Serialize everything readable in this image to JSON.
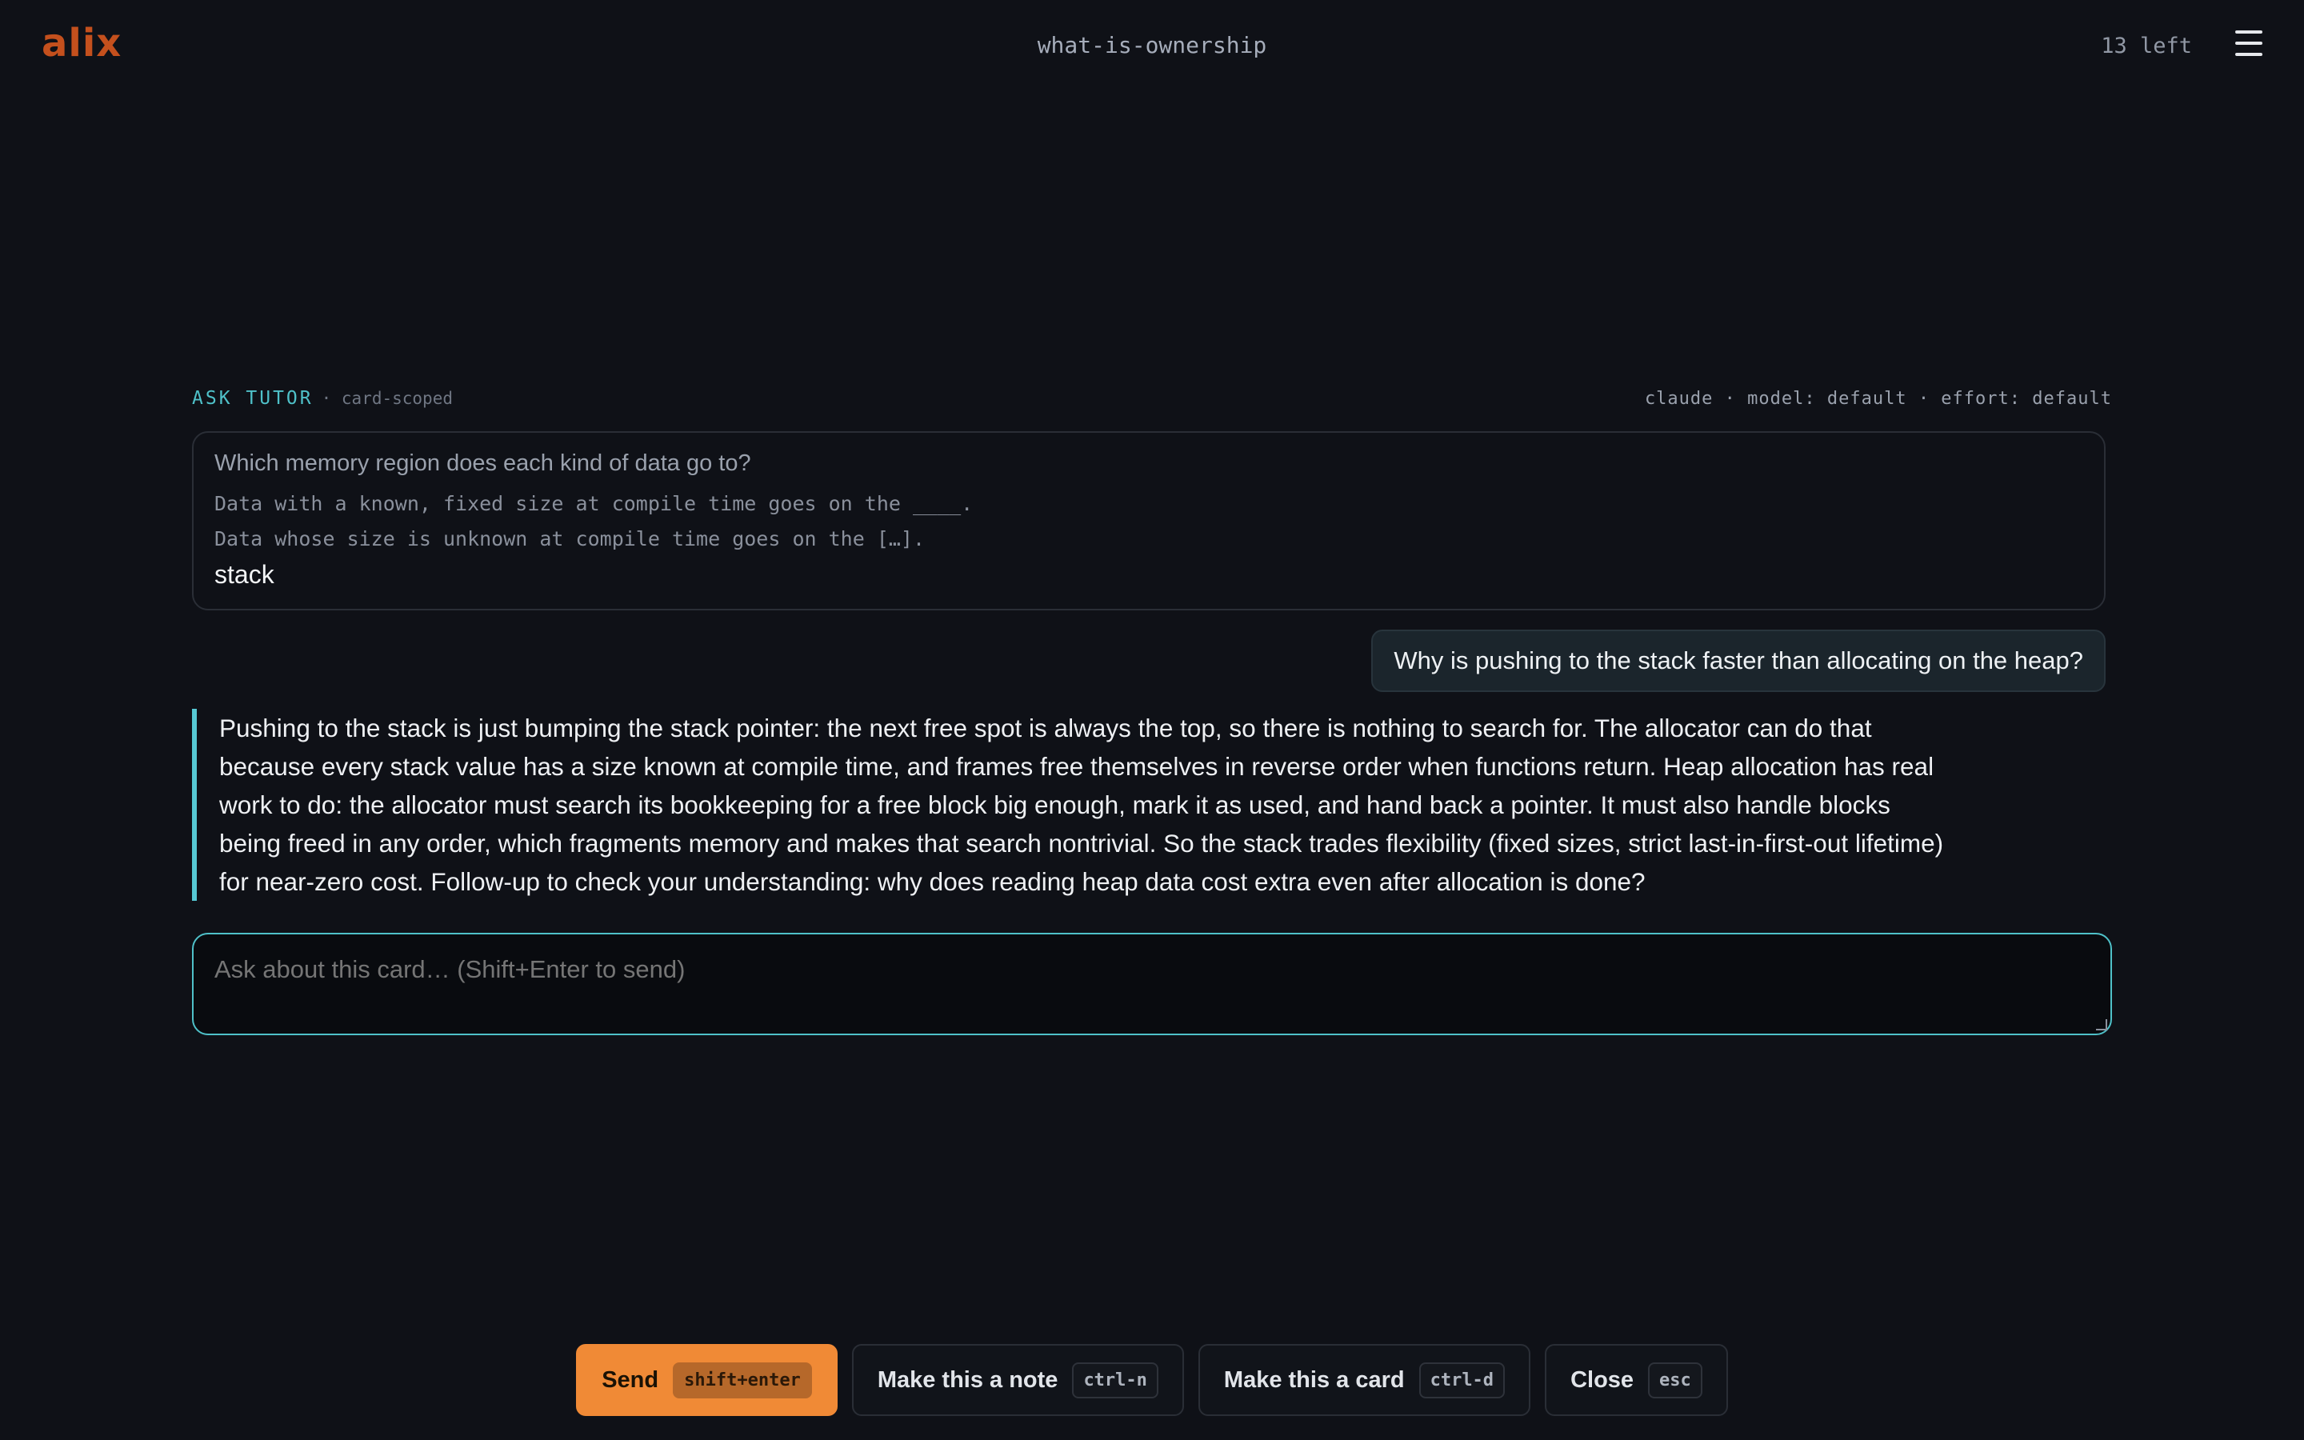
{
  "header": {
    "logo": "alix",
    "deck_title": "what-is-ownership",
    "remaining": "13 left"
  },
  "tutor": {
    "label": "ASK TUTOR",
    "scope": "· card-scoped",
    "model_info": "claude · model: default · effort: default"
  },
  "card": {
    "question": "Which memory region does each kind of data go to?",
    "lines": [
      "Data with a known, fixed size at compile time goes on the ____.",
      "Data whose size is unknown at compile time goes on the […]."
    ],
    "answer": "stack"
  },
  "conversation": {
    "user_message": "Why is pushing to the stack faster than allocating on the heap?",
    "tutor_reply": "Pushing to the stack is just bumping the stack pointer: the next free spot is always the top, so there is nothing to search for. The allocator can do that because every stack value has a size known at compile time, and frames free themselves in reverse order when functions return. Heap allocation has real work to do: the allocator must search its bookkeeping for a free block big enough, mark it as used, and hand back a pointer. It must also handle blocks being freed in any order, which fragments memory and makes that search nontrivial. So the stack trades flexibility (fixed sizes, strict last-in-first-out lifetime) for near-zero cost. Follow-up to check your understanding: why does reading heap data cost extra even after allocation is done?"
  },
  "input": {
    "placeholder": "Ask about this card… (Shift+Enter to send)"
  },
  "actions": {
    "send": {
      "label": "Send",
      "shortcut": "shift+enter"
    },
    "note": {
      "label": "Make this a note",
      "shortcut": "ctrl-n"
    },
    "card": {
      "label": "Make this a card",
      "shortcut": "ctrl-d"
    },
    "close": {
      "label": "Close",
      "shortcut": "esc"
    }
  },
  "icons": {
    "menu": "hamburger-menu-icon"
  },
  "colors": {
    "accent": "#4fc1c9",
    "brand": "#c4501d",
    "primary_button": "#f08a36",
    "background": "#0f1117"
  }
}
